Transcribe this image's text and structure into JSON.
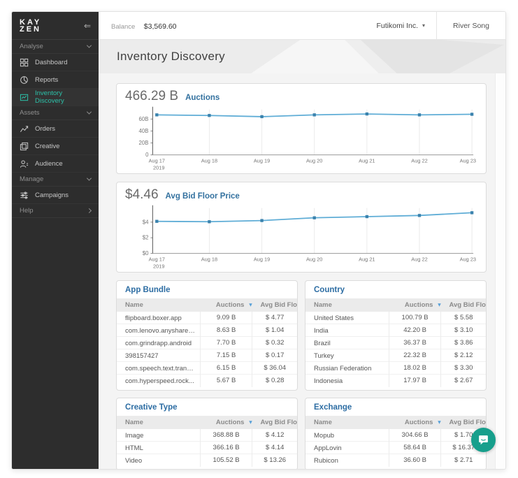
{
  "sidebar": {
    "logo_line1": "KAY",
    "logo_line2": "ZEN",
    "sections": [
      {
        "label": "Analyse",
        "chevron": "down",
        "items": [
          {
            "label": "Dashboard",
            "icon": "dashboard",
            "active": false
          },
          {
            "label": "Reports",
            "icon": "reports",
            "active": false
          },
          {
            "label": "Inventory Discovery",
            "icon": "inventory-discovery",
            "active": true
          }
        ]
      },
      {
        "label": "Assets",
        "chevron": "down",
        "items": [
          {
            "label": "Orders",
            "icon": "orders",
            "active": false
          },
          {
            "label": "Creative",
            "icon": "creative",
            "active": false
          },
          {
            "label": "Audience",
            "icon": "audience",
            "active": false
          }
        ]
      },
      {
        "label": "Manage",
        "chevron": "down",
        "items": [
          {
            "label": "Campaigns",
            "icon": "campaigns",
            "active": false
          }
        ]
      },
      {
        "label": "Help",
        "chevron": "right",
        "items": []
      }
    ]
  },
  "topbar": {
    "balance_label": "Balance",
    "balance_value": "$3,569.60",
    "account": "Futikomi Inc.",
    "user": "River Song"
  },
  "page": {
    "title": "Inventory Discovery"
  },
  "chart_data": [
    {
      "type": "line",
      "title": "Auctions",
      "summary_value": "466.29 B",
      "x": [
        "Aug 17",
        "Aug 18",
        "Aug 19",
        "Aug 20",
        "Aug 21",
        "Aug 22",
        "Aug 23"
      ],
      "x_first_sub": "2019",
      "values": [
        67,
        66,
        64,
        67,
        68.5,
        67,
        68
      ],
      "ylim": [
        0,
        76
      ],
      "yticks": [
        0,
        20,
        40,
        60
      ],
      "ytick_labels": [
        "0",
        "20B",
        "40B",
        "60B"
      ],
      "grid": "vertical",
      "line_color": "#5fadd6",
      "marker_color": "#3a82ad"
    },
    {
      "type": "line",
      "title": "Avg Bid Floor Price",
      "summary_value": "$4.46",
      "x": [
        "Aug 17",
        "Aug 18",
        "Aug 19",
        "Aug 20",
        "Aug 21",
        "Aug 22",
        "Aug 23"
      ],
      "x_first_sub": "2019",
      "values": [
        4.1,
        4.05,
        4.2,
        4.55,
        4.7,
        4.85,
        5.2
      ],
      "ylim": [
        0,
        5.8
      ],
      "yticks": [
        0,
        2,
        4
      ],
      "ytick_labels": [
        "$0",
        "$2",
        "$4"
      ],
      "grid": "vertical",
      "line_color": "#5fadd6",
      "marker_color": "#3a82ad"
    }
  ],
  "table_columns": {
    "name": "Name",
    "auctions": "Auctions",
    "avg_bid": "Avg Bid Flo..."
  },
  "tables": [
    {
      "title": "App Bundle",
      "rows": [
        {
          "name": "flipboard.boxer.app",
          "auctions": "9.09 B",
          "avg_bid": "$ 4.77"
        },
        {
          "name": "com.lenovo.anyshare....",
          "auctions": "8.63 B",
          "avg_bid": "$ 1.04"
        },
        {
          "name": "com.grindrapp.android",
          "auctions": "7.70 B",
          "avg_bid": "$ 0.32"
        },
        {
          "name": "398157427",
          "auctions": "7.15 B",
          "avg_bid": "$ 0.17"
        },
        {
          "name": "com.speech.text.trans...",
          "auctions": "6.15 B",
          "avg_bid": "$ 36.04"
        },
        {
          "name": "com.hyperspeed.rock...",
          "auctions": "5.67 B",
          "avg_bid": "$ 0.28"
        }
      ]
    },
    {
      "title": "Country",
      "rows": [
        {
          "name": "United States",
          "auctions": "100.79 B",
          "avg_bid": "$ 5.58"
        },
        {
          "name": "India",
          "auctions": "42.20 B",
          "avg_bid": "$ 3.10"
        },
        {
          "name": "Brazil",
          "auctions": "36.37 B",
          "avg_bid": "$ 3.86"
        },
        {
          "name": "Turkey",
          "auctions": "22.32 B",
          "avg_bid": "$ 2.12"
        },
        {
          "name": "Russian Federation",
          "auctions": "18.02 B",
          "avg_bid": "$ 3.30"
        },
        {
          "name": "Indonesia",
          "auctions": "17.97 B",
          "avg_bid": "$ 2.67"
        }
      ]
    },
    {
      "title": "Creative Type",
      "rows": [
        {
          "name": "Image",
          "auctions": "368.88 B",
          "avg_bid": "$ 4.12"
        },
        {
          "name": "HTML",
          "auctions": "366.16 B",
          "avg_bid": "$ 4.14"
        },
        {
          "name": "Video",
          "auctions": "105.52 B",
          "avg_bid": "$ 13.26"
        }
      ]
    },
    {
      "title": "Exchange",
      "rows": [
        {
          "name": "Mopub",
          "auctions": "304.66 B",
          "avg_bid": "$ 1.70"
        },
        {
          "name": "AppLovin",
          "auctions": "58.64 B",
          "avg_bid": "$ 16.37"
        },
        {
          "name": "Rubicon",
          "auctions": "36.60 B",
          "avg_bid": "$ 2.71"
        }
      ]
    }
  ],
  "colors": {
    "sidebar_bg": "#2d2d2d",
    "accent_teal": "#2cc0a8",
    "chat_teal": "#179f8c",
    "chart_line": "#5fadd6",
    "chart_marker": "#3a82ad",
    "heading_blue": "#33719f",
    "sort_caret_blue": "#58a0d8"
  }
}
